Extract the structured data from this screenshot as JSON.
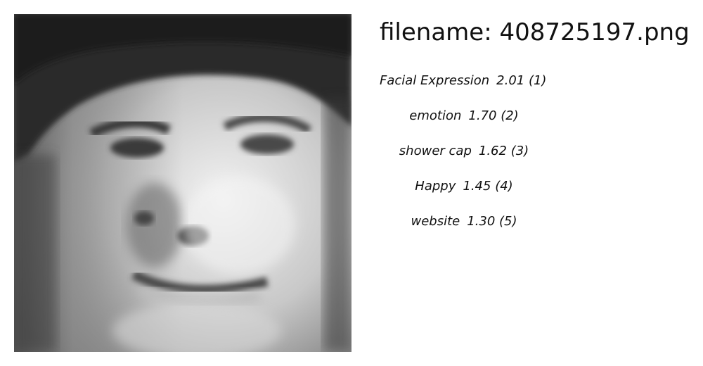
{
  "filename_label": "filename: 408725197.png",
  "labels": [
    {
      "name": "Facial Expression",
      "score": "2.01",
      "rank": "(1)"
    },
    {
      "name": "emotion",
      "score": "1.70",
      "rank": "(2)"
    },
    {
      "name": "shower cap",
      "score": "1.62",
      "rank": "(3)"
    },
    {
      "name": "Happy",
      "score": "1.45",
      "rank": "(4)"
    },
    {
      "name": "website",
      "score": "1.30",
      "rank": "(5)"
    }
  ]
}
